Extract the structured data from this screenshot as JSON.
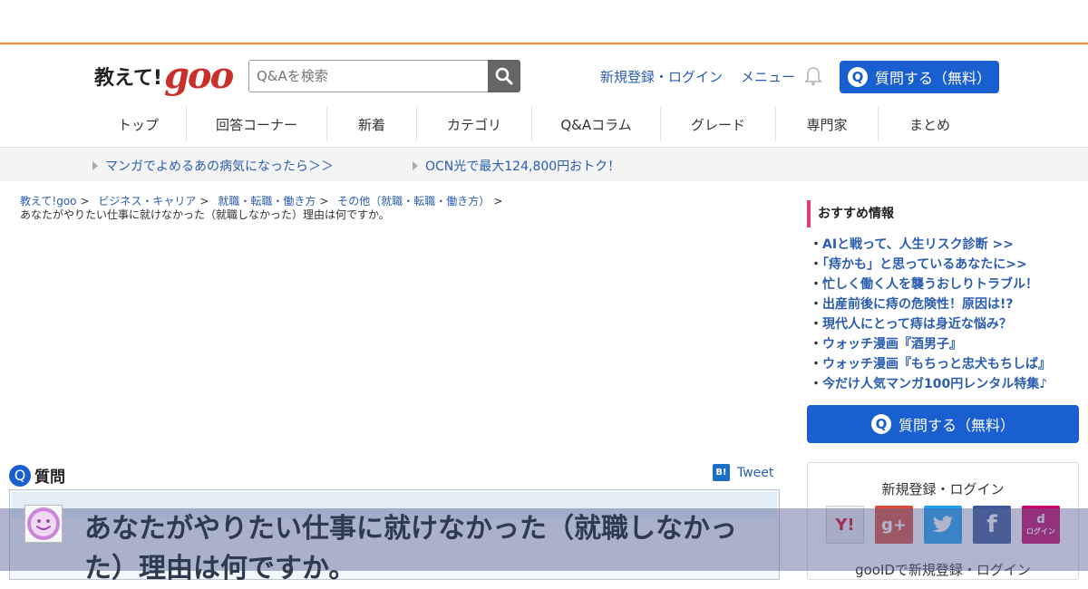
{
  "header": {
    "logo_text": "教えて!",
    "logo_brand": "goo",
    "search_placeholder": "Q&Aを検索",
    "login_link": "新規登録・ログイン",
    "menu_link": "メニュー",
    "ask_button": "質問する（無料）",
    "ask_badge": "Q"
  },
  "nav": {
    "items": [
      "トップ",
      "回答コーナー",
      "新着",
      "カテゴリ",
      "Q&Aコラム",
      "グレード",
      "専門家",
      "まとめ"
    ]
  },
  "promo": {
    "links": [
      "マンガでよめるあの病気になったら＞＞",
      "OCN光で最大124,800円おトク！"
    ]
  },
  "breadcrumb": {
    "crumbs": [
      "教えて!goo",
      "ビジネス・キャリア",
      "就職・転職・働き方",
      "その他（就職・転職・働き方）"
    ],
    "separator": ">",
    "current": "あなたがやりたい仕事に就けなかった（就職しなかった）理由は何ですか。"
  },
  "question": {
    "badge": "Q",
    "heading": "質問",
    "hatebu": "B!",
    "tweet": "Tweet",
    "title": "あなたがやりたい仕事に就けなかった（就職しなかった）理由は何ですか。"
  },
  "sidebar": {
    "title": "おすすめ情報",
    "bullet": "・",
    "items": [
      "AIと戦って、人生リスク診断 >>",
      "「痔かも」と思っているあなたに>>",
      "忙しく働く人を襲うおしりトラブル！",
      "出産前後に痔の危険性！原因は!?",
      "現代人にとって痔は身近な悩み？",
      "ウォッチ漫画『酒男子』",
      "ウォッチ漫画『もちっと忠犬もちしば』",
      "今だけ人気マンガ100円レンタル特集♪"
    ],
    "ask_button": "質問する（無料）",
    "ask_badge": "Q",
    "login_title": "新規登録・ログイン",
    "sns": {
      "yahoo": "Y!",
      "google": "g+",
      "facebook": "f",
      "docomo": "ログイン"
    },
    "gooid": "gooIDで新規登録・ログイン"
  },
  "colors": {
    "accent": "#1a5fd0",
    "top_line": "#f28c3a",
    "side_marker": "#e03b6e",
    "link": "#2a5db0"
  }
}
